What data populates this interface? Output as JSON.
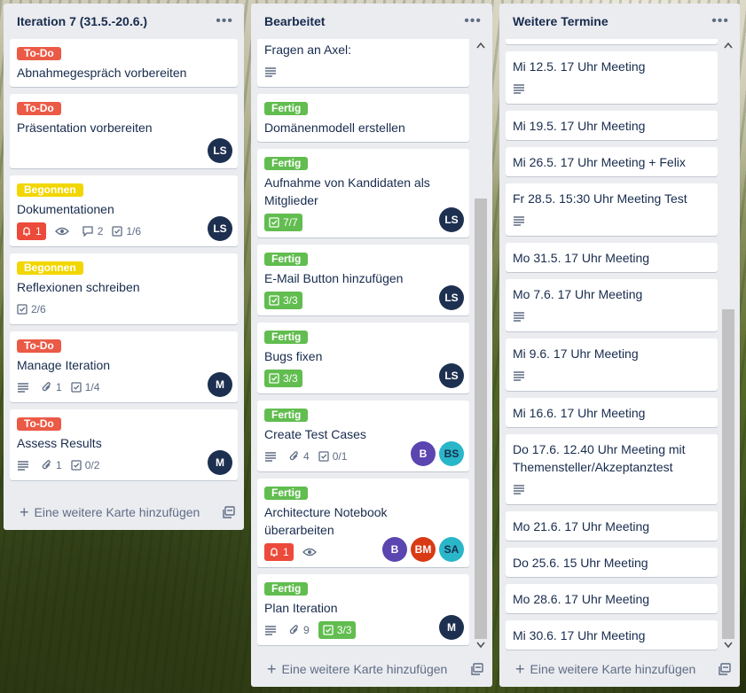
{
  "lists": [
    {
      "title": "Iteration 7 (31.5.-20.6.)",
      "add_card": "Eine weitere Karte hinzufügen",
      "cards": [
        {
          "label": "To-Do",
          "title": "Abnahmegespräch vorbereiten"
        },
        {
          "label": "To-Do",
          "title": "Präsentation vorbereiten",
          "members": [
            "LS"
          ]
        },
        {
          "label": "Begonnen",
          "title": "Dokumentationen",
          "notifications": "1",
          "comments": "2",
          "checklist": "1/6",
          "members": [
            "LS"
          ]
        },
        {
          "label": "Begonnen",
          "title": "Reflexionen schreiben",
          "checklist": "2/6"
        },
        {
          "label": "To-Do",
          "title": "Manage Iteration",
          "attachments": "1",
          "checklist": "1/4",
          "members": [
            "M"
          ]
        },
        {
          "label": "To-Do",
          "title": "Assess Results",
          "attachments": "1",
          "checklist": "0/2",
          "members": [
            "M"
          ]
        }
      ]
    },
    {
      "title": "Bearbeitet",
      "add_card": "Eine weitere Karte hinzufügen",
      "cards": [
        {
          "title": "Fragen an Axel:"
        },
        {
          "label": "Fertig",
          "title": "Domänenmodell erstellen"
        },
        {
          "label": "Fertig",
          "title": "Aufnahme von Kandidaten als Mitglieder",
          "checklist": "7/7",
          "members": [
            "LS"
          ]
        },
        {
          "label": "Fertig",
          "title": "E-Mail Button hinzufügen",
          "checklist": "3/3",
          "members": [
            "LS"
          ]
        },
        {
          "label": "Fertig",
          "title": "Bugs fixen",
          "checklist": "3/3",
          "members": [
            "LS"
          ]
        },
        {
          "label": "Fertig",
          "title": "Create Test Cases",
          "attachments": "4",
          "checklist": "0/1",
          "members": [
            "B",
            "BS"
          ]
        },
        {
          "label": "Fertig",
          "title": "Architecture Notebook überarbeiten",
          "notifications": "1",
          "members": [
            "B",
            "BM",
            "SA"
          ]
        },
        {
          "label": "Fertig",
          "title": "Plan Iteration",
          "attachments": "9",
          "checklist": "3/3",
          "members": [
            "M"
          ]
        }
      ]
    },
    {
      "title": "Weitere Termine",
      "add_card": "Eine weitere Karte hinzufügen",
      "cards": [
        {
          "title": "Mi 12.5. 17 Uhr Meeting"
        },
        {
          "title": "Mi 19.5. 17 Uhr Meeting"
        },
        {
          "title": "Mi 26.5. 17 Uhr Meeting + Felix"
        },
        {
          "title": "Fr 28.5. 15:30 Uhr Meeting Test"
        },
        {
          "title": "Mo 31.5. 17 Uhr Meeting"
        },
        {
          "title": "Mo 7.6. 17 Uhr Meeting"
        },
        {
          "title": "Mi 9.6. 17 Uhr Meeting"
        },
        {
          "title": "Mi 16.6. 17 Uhr Meeting"
        },
        {
          "title": "Do 17.6. 12.40 Uhr Meeting mit Themensteller/Akzeptanztest"
        },
        {
          "title": "Mo 21.6. 17 Uhr Meeting"
        },
        {
          "title": "Do 25.6. 15 Uhr Meeting"
        },
        {
          "title": "Mo 28.6. 17 Uhr Meeting"
        },
        {
          "title": "Mi 30.6. 17 Uhr Meeting"
        }
      ]
    }
  ],
  "colors": {
    "todo": "#eb5a46",
    "begonnen": "#f2d600",
    "fertig": "#61bd4f",
    "notification": "#ec4a3a",
    "list_bg": "#ebecf0"
  }
}
